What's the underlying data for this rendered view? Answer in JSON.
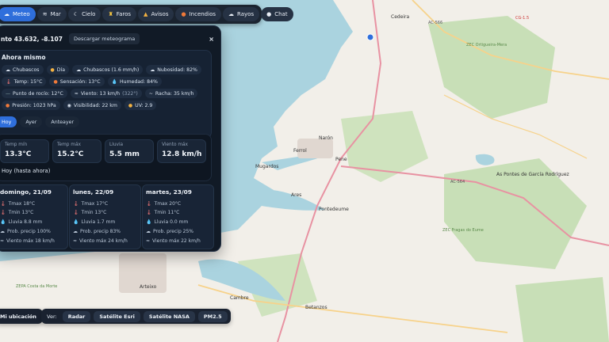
{
  "topbar": {
    "items": [
      {
        "label": "Meteo",
        "icon": "cloud-icon"
      },
      {
        "label": "Mar",
        "icon": "wave-icon"
      },
      {
        "label": "Cielo",
        "icon": "moon-icon"
      },
      {
        "label": "Faros",
        "icon": "lighthouse-icon"
      },
      {
        "label": "Avisos",
        "icon": "warning-icon"
      },
      {
        "label": "Incendios",
        "icon": "fire-icon"
      },
      {
        "label": "Rayos",
        "icon": "lightning-icon"
      },
      {
        "label": "Chat",
        "icon": "chat-icon"
      }
    ]
  },
  "panel": {
    "title": "nto 43.632, -8.107",
    "download_label": "Descargar meteograma",
    "close_label": "×",
    "now_heading": "Ahora mismo",
    "chips_row1": [
      "Chubascos",
      "Día",
      "Chubascos (1.6 mm/h)",
      "Nubosidad: 82%"
    ],
    "chips_row2": [
      "Temp: 15°C",
      "Sensación: 13°C",
      "Humedad: 84%"
    ],
    "chips_row3": [
      "Punto de rocío: 12°C",
      "Viento: 13 km/h",
      "(322°)",
      "Racha: 35 km/h"
    ],
    "chips_row4": [
      "Presión: 1023 hPa",
      "Visibilidad: 22 km",
      "UV: 2.9"
    ],
    "day_tabs": [
      "Hoy",
      "Ayer",
      "Anteayer"
    ],
    "summary": {
      "label": "Hoy (hasta ahora)",
      "stats": [
        {
          "label": "Temp mín",
          "value": "13.3°C"
        },
        {
          "label": "Temp máx",
          "value": "15.2°C"
        },
        {
          "label": "Lluvia",
          "value": "5.5 mm"
        },
        {
          "label": "Viento máx",
          "value": "12.8 km/h"
        }
      ]
    },
    "forecast": [
      {
        "day": "domingo, 21/09",
        "tmax": "Tmax 18°C",
        "tmin": "Tmin 13°C",
        "rain": "Lluvia 8.8 mm",
        "prob": "Prob. precip 100%",
        "wind": "Viento máx 18 km/h"
      },
      {
        "day": "lunes, 22/09",
        "tmax": "Tmax 17°C",
        "tmin": "Tmin 13°C",
        "rain": "Lluvia 1.7 mm",
        "prob": "Prob. precip 83%",
        "wind": "Viento máx 24 km/h"
      },
      {
        "day": "martes, 23/09",
        "tmax": "Tmax 20°C",
        "tmin": "Tmin 11°C",
        "rain": "Lluvia 0.0 mm",
        "prob": "Prob. precip 25%",
        "wind": "Viento máx 22 km/h"
      }
    ]
  },
  "map": {
    "places": [
      "Cedeira",
      "AC-566",
      "CG-1.5",
      "ZEC Ortigueira-Mera",
      "Narón",
      "Ferrol",
      "Mugardos",
      "Pene",
      "Ares",
      "Pontedeume",
      "AC-564",
      "As Pontes de García Rodríguez",
      "ZEC Fragas do Eume",
      "Arteixo",
      "ZEPA Costa da Morte",
      "Cambre",
      "Betanzos"
    ]
  },
  "bottom": {
    "location_label": "Mi ubicación",
    "view_label": "Ver:",
    "view_buttons": [
      "Radar",
      "Satélite Esri",
      "Satélite NASA",
      "PM2.5"
    ]
  },
  "colors": {
    "accent": "#2f6fdc",
    "panel_bg": "#111a26",
    "sea": "#aad3df",
    "land": "#f2efe9",
    "forest": "#add19e"
  }
}
